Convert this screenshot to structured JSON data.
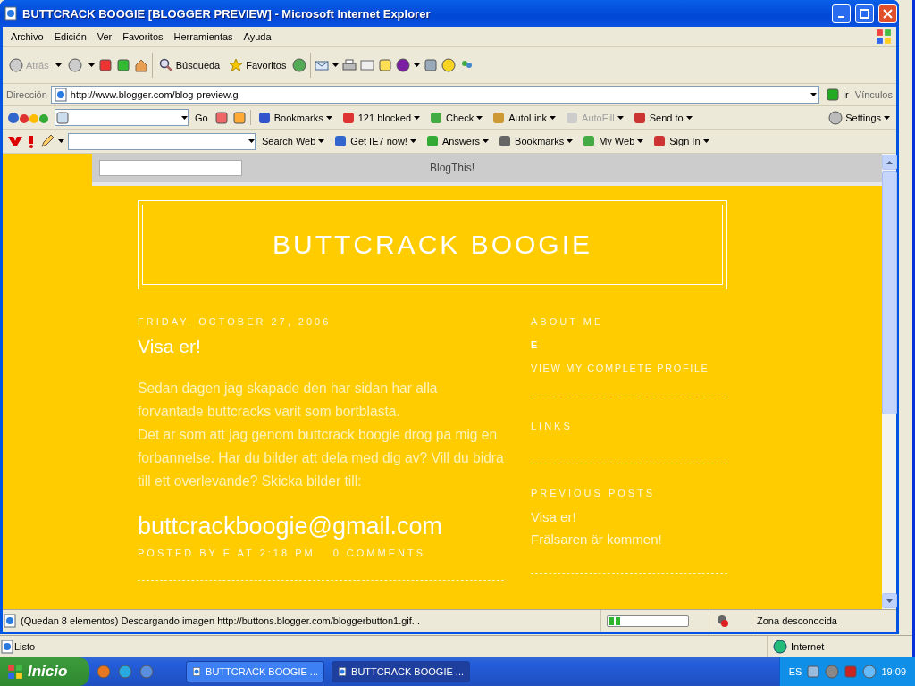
{
  "window": {
    "title": "BUTTCRACK BOOGIE [BLOGGER PREVIEW] - Microsoft Internet Explorer"
  },
  "menu": [
    "Archivo",
    "Edición",
    "Ver",
    "Favoritos",
    "Herramientas",
    "Ayuda"
  ],
  "toolbar": {
    "back": {
      "label": "Atrás",
      "disabled": true
    },
    "search": {
      "label": "Búsqueda"
    },
    "favorites": {
      "label": "Favoritos"
    }
  },
  "address": {
    "label": "Dirección",
    "url": "http://www.blogger.com/blog-preview.g",
    "go": "Ir",
    "links": "Vínculos"
  },
  "google_toolbar": {
    "go": "Go",
    "items": [
      {
        "label": "Bookmarks",
        "disabled": false
      },
      {
        "label": "121 blocked",
        "disabled": false
      },
      {
        "label": "Check",
        "disabled": false
      },
      {
        "label": "AutoLink",
        "disabled": false
      },
      {
        "label": "AutoFill",
        "disabled": true
      },
      {
        "label": "Send to",
        "disabled": false
      }
    ],
    "settings": "Settings"
  },
  "yahoo_toolbar": {
    "items": [
      "Search Web",
      "Get IE7 now!",
      "Answers",
      "Bookmarks",
      "My Web",
      "Sign In"
    ]
  },
  "blogger_navbar": {
    "button": "BlogThis!"
  },
  "blog": {
    "title": "BUTTCRACK BOOGIE",
    "post": {
      "date": "FRIDAY, OCTOBER 27, 2006",
      "title": "Visa er!",
      "paragraphs": [
        "Sedan dagen jag skapade den har sidan har alla forvantade buttcracks varit som bortblasta.",
        "Det ar som att jag genom buttcrack boogie drog pa mig en forbannelse. Har du bilder att dela med dig av? Vill du bidra till ett overlevande? Skicka bilder till:"
      ],
      "email": "buttcrackboogie@gmail.com",
      "byline": "POSTED BY E AT 2:18 PM",
      "comments": "0 COMMENTS"
    },
    "sidebar": {
      "about_heading": "ABOUT ME",
      "name": "E",
      "profile_link": "VIEW MY COMPLETE PROFILE",
      "links_heading": "LINKS",
      "previous_heading": "PREVIOUS POSTS",
      "previous_posts": [
        "Visa er!",
        "Frälsaren är kommen!"
      ]
    }
  },
  "status_bar": {
    "text": "(Quedan 8 elementos) Descargando imagen http://buttons.blogger.com/bloggerbutton1.gif...",
    "progress": {
      "level": 0.15
    },
    "zone": "Zona desconocida"
  },
  "back_window": {
    "status": "Listo",
    "zone": "Internet"
  },
  "taskbar": {
    "start": "Inicio",
    "tasks": [
      {
        "label": "BUTTCRACK BOOGIE ...",
        "selected": false
      },
      {
        "label": "BUTTCRACK BOOGIE ...",
        "selected": true
      }
    ],
    "language": "ES",
    "clock": "19:09"
  }
}
